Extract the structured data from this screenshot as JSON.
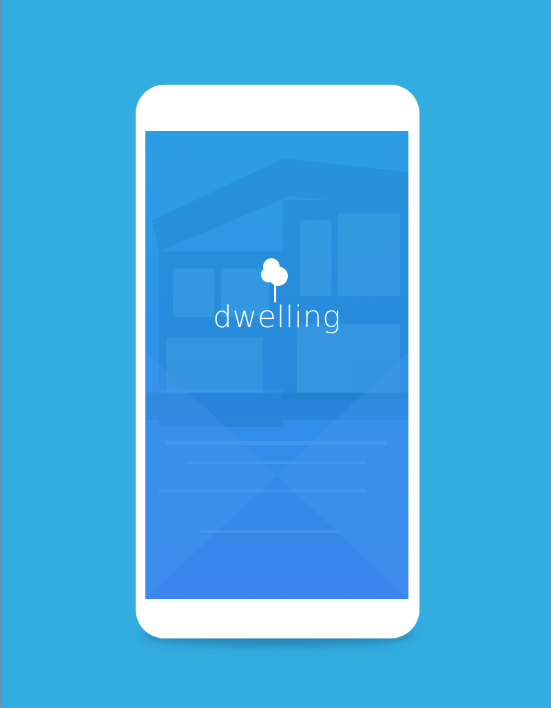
{
  "brand": {
    "name": "dwelling",
    "logo_icon": "tree-icon"
  },
  "colors": {
    "background": "#33ACE0",
    "phone_frame": "#FFFFFF",
    "screen_overlay": "#2E8FE8",
    "logo": "#FFFFFF"
  }
}
